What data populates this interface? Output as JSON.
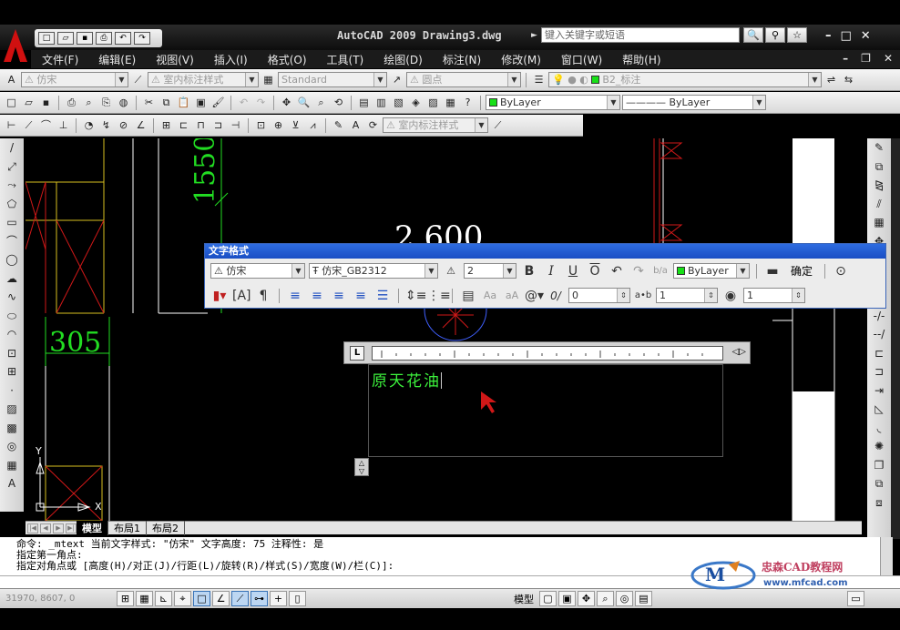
{
  "window": {
    "title": "AutoCAD 2009 Drawing3.dwg",
    "search_placeholder": "键入关键字或短语",
    "app_logo_letter": "A"
  },
  "menu": [
    "文件(F)",
    "编辑(E)",
    "视图(V)",
    "插入(I)",
    "格式(O)",
    "工具(T)",
    "绘图(D)",
    "标注(N)",
    "修改(M)",
    "窗口(W)",
    "帮助(H)"
  ],
  "styles_toolbar": {
    "text_style": "仿宋",
    "dim_style": "室内标注样式",
    "table_style": "Standard",
    "multileader_style": "圆点",
    "layer": "B2_标注"
  },
  "properties_toolbar": {
    "color": "ByLayer",
    "linetype": "ByLayer"
  },
  "dim_toolbar": {
    "dim_style": "室内标注样式"
  },
  "drawing": {
    "dim_vertical": "1550",
    "dim_horizontal": "305",
    "partial_dim": "2 600",
    "ucs_x": "X",
    "ucs_y": "Y"
  },
  "text_formatting": {
    "title": "文字格式",
    "style": "仿宋",
    "font": "仿宋_GB2312",
    "height": "2",
    "color": "ByLayer",
    "ok_label": "确定",
    "oblique": "0",
    "tracking": "1",
    "width_factor": "1"
  },
  "mtext": {
    "content": "原天花油"
  },
  "layout_tabs": [
    "模型",
    "布局1",
    "布局2"
  ],
  "command_lines": [
    "命令: _mtext 当前文字样式: \"仿宋\" 文字高度: 75 注释性: 是",
    "指定第一角点:",
    "指定对角点或 [高度(H)/对正(J)/行距(L)/旋转(R)/样式(S)/宽度(W)/栏(C)]:"
  ],
  "status": {
    "coords": "31970, 8607, 0",
    "model_label": "模型"
  },
  "watermark": {
    "name": "忠森CAD教程网",
    "url": "www.mfcad.com"
  },
  "colors": {
    "dim_green": "#22dd22",
    "wall_red": "#d01818",
    "wall_yellow": "#d8c020",
    "mtext_green": "#3cf03c"
  }
}
